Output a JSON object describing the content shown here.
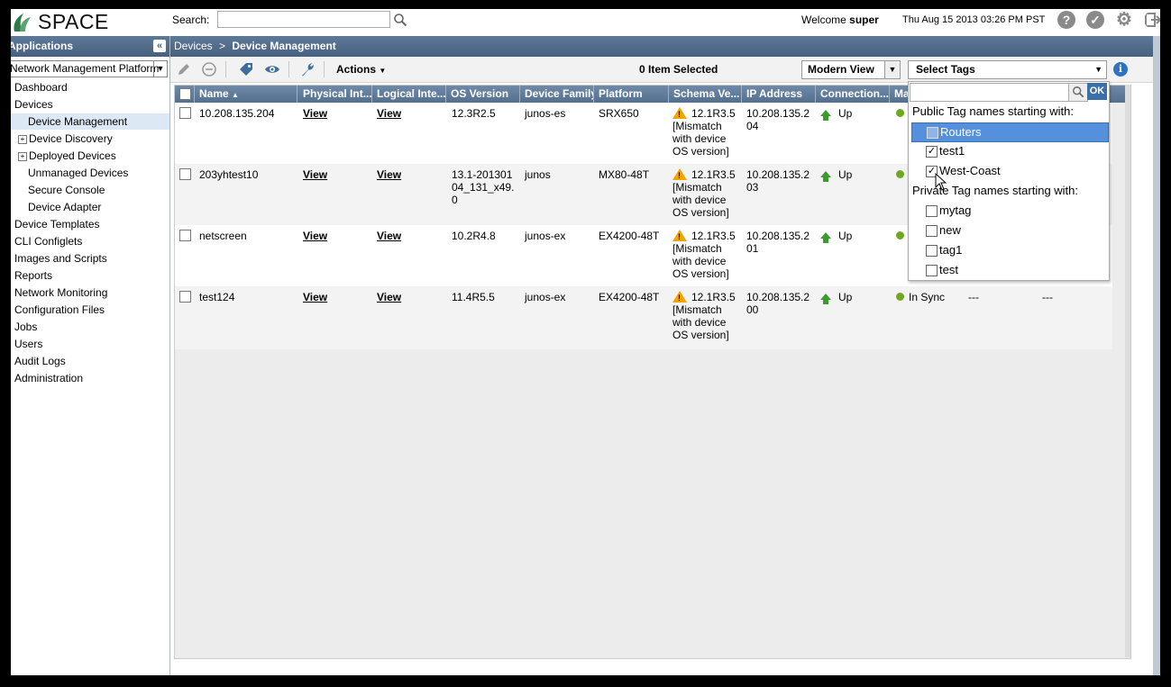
{
  "header": {
    "logo_text": "SPACE",
    "search_label": "Search:",
    "search_value": "",
    "welcome_text": "Welcome",
    "user": "super",
    "datetime": "Thu Aug 15 2013 03:26 PM PST",
    "icons": [
      "help-icon",
      "status-check-icon",
      "settings-gear-icon",
      "logout-icon"
    ]
  },
  "left_panel": {
    "title": "Applications",
    "app_select": "Network Management Platform",
    "items": [
      {
        "label": "Dashboard"
      },
      {
        "label": "Devices"
      },
      {
        "label": "Device Management"
      },
      {
        "label": "Device Discovery"
      },
      {
        "label": "Deployed Devices"
      },
      {
        "label": "Unmanaged Devices"
      },
      {
        "label": "Secure Console"
      },
      {
        "label": "Device Adapter"
      },
      {
        "label": "Device Templates"
      },
      {
        "label": "CLI Configlets"
      },
      {
        "label": "Images and Scripts"
      },
      {
        "label": "Reports"
      },
      {
        "label": "Network Monitoring"
      },
      {
        "label": "Configuration Files"
      },
      {
        "label": "Jobs"
      },
      {
        "label": "Users"
      },
      {
        "label": "Audit Logs"
      },
      {
        "label": "Administration"
      }
    ]
  },
  "breadcrumb": {
    "root": "Devices",
    "separator": ">",
    "current": "Device Management"
  },
  "toolbar": {
    "actions_label": "Actions",
    "selected_count": "0 Item Selected",
    "view_label": "Modern View",
    "tags_label": "Select Tags"
  },
  "grid": {
    "columns": [
      "Name",
      "Physical Int...",
      "Logical Inte...",
      "OS Version",
      "Device Family",
      "Platform",
      "Schema Ve...",
      "IP Address",
      "Connection...",
      "Ma"
    ],
    "rows": [
      {
        "name": "10.208.135.204",
        "phys": "View",
        "logical": "View",
        "os": "12.3R2.5",
        "family": "junos-es",
        "platform": "SRX650",
        "schema": "12.1R3.5",
        "schema_note": "[Mismatch with device OS version]",
        "ip": "10.208.135.204",
        "conn": "Up",
        "sync": ""
      },
      {
        "name": "203yhtest10",
        "phys": "View",
        "logical": "View",
        "os": "13.1-20130104_131_x49.0",
        "family": "junos",
        "platform": "MX80-48T",
        "schema": "12.1R3.5",
        "schema_note": "[Mismatch with device OS version]",
        "ip": "10.208.135.203",
        "conn": "Up",
        "sync": ""
      },
      {
        "name": "netscreen",
        "phys": "View",
        "logical": "View",
        "os": "10.2R4.8",
        "family": "junos-ex",
        "platform": "EX4200-48T",
        "schema": "12.1R3.5",
        "schema_note": "[Mismatch with device OS version]",
        "ip": "10.208.135.201",
        "conn": "Up",
        "sync": ""
      },
      {
        "name": "test124",
        "phys": "View",
        "logical": "View",
        "os": "11.4R5.5",
        "family": "junos-ex",
        "platform": "EX4200-48T",
        "schema": "12.1R3.5",
        "schema_note": "[Mismatch with device OS version]",
        "ip": "10.208.135.200",
        "conn": "Up",
        "sync": "In Sync",
        "col_a": "---",
        "col_b": "---"
      }
    ]
  },
  "tags_panel": {
    "ok_label": "OK",
    "public_heading": "Public Tag names starting with:",
    "public_tags": [
      {
        "label": "Routers",
        "checked": false,
        "highlighted": true
      },
      {
        "label": "test1",
        "checked": true
      },
      {
        "label": "West-Coast",
        "checked": true
      }
    ],
    "private_heading": "Private Tag names starting with:",
    "private_tags": [
      {
        "label": "mytag",
        "checked": false
      },
      {
        "label": "new",
        "checked": false
      },
      {
        "label": "tag1",
        "checked": false
      },
      {
        "label": "test",
        "checked": false
      }
    ]
  }
}
